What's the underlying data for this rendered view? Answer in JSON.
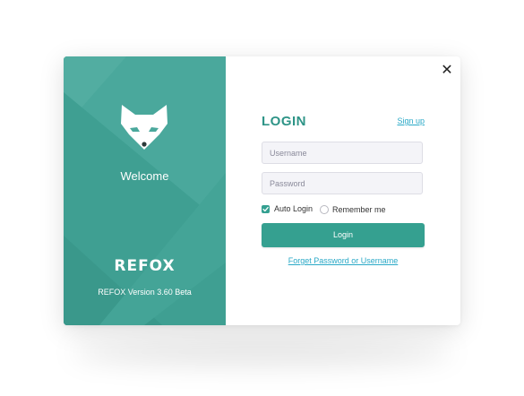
{
  "brand": {
    "welcome": "Welcome",
    "logo_text": "REFOX",
    "version": "REFOX Version 3.60 Beta",
    "panel_color": "#4aa89c",
    "logo_icon": "fox-icon"
  },
  "dialog": {
    "close_icon": "close-icon",
    "close_glyph": "✕"
  },
  "login": {
    "title": "LOGIN",
    "signup_link": "Sign up",
    "username_placeholder": "Username",
    "password_placeholder": "Password",
    "auto_login_label": "Auto Login",
    "auto_login_checked": true,
    "remember_me_label": "Remember me",
    "remember_me_checked": false,
    "login_button": "Login",
    "forgot_link": "Forget Password or Username",
    "accent_color": "#35a090",
    "link_color": "#2aa9c7"
  }
}
